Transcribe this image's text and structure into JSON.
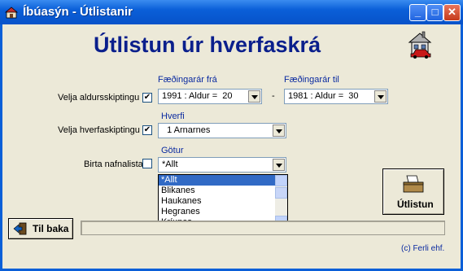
{
  "window": {
    "title": "Íbúasýn - Útlistanir"
  },
  "heading": "Útlistun úr  hverfaskrá",
  "age_row": {
    "label": "Velja aldursskiptingu",
    "checked": true,
    "from_label": "Fæðingarár frá",
    "from_value": "1991 : Aldur =  20",
    "dash": "-",
    "to_label": "Fæðingarár til",
    "to_value": "1981 : Aldur =  30"
  },
  "district_row": {
    "label": "Velja hverfaskiptingu",
    "checked": true,
    "field_label": "Hverfi",
    "value": "  1 Arnarnes"
  },
  "names_row": {
    "label": "Birta nafnalista",
    "checked": false,
    "field_label": "Götur",
    "value": "*Allt",
    "options": [
      "*Allt",
      "Blikanes",
      "Haukanes",
      "Hegranes",
      "Kríunes"
    ]
  },
  "buttons": {
    "output": "Útlistun",
    "back": "Til baka"
  },
  "progress": 0,
  "copyright": "(c) Ferli ehf."
}
